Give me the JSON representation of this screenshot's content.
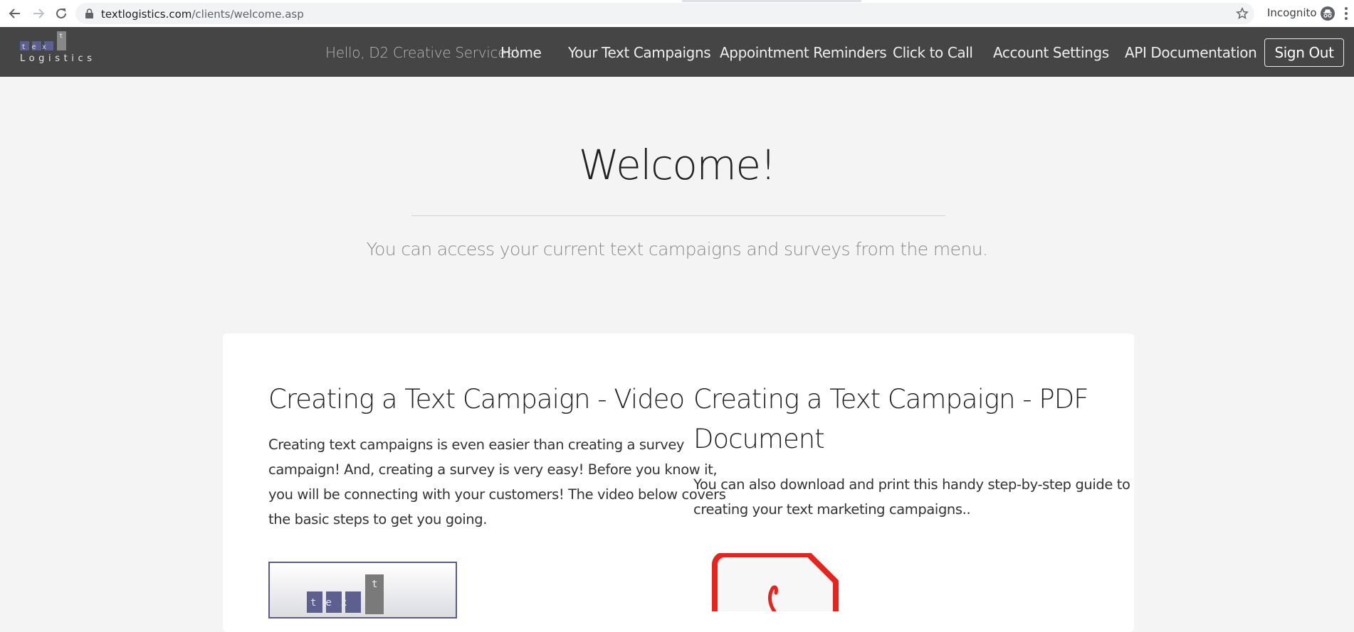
{
  "browser": {
    "url_domain": "textlogistics.com",
    "url_path": "/clients/welcome.asp",
    "incognito_label": "Incognito"
  },
  "nav": {
    "logo_text_top": "tex",
    "logo_text_t": "t",
    "logo_text_bottom": "Logistics",
    "greeting": "Hello, D2 Creative Services!",
    "links": [
      {
        "label": "Home"
      },
      {
        "label": "Your Text Campaigns"
      },
      {
        "label": "Appointment Reminders"
      },
      {
        "label": "Click to Call"
      },
      {
        "label": "Account Settings"
      },
      {
        "label": "API Documentation"
      }
    ],
    "signout_label": "Sign Out"
  },
  "hero": {
    "title": "Welcome!",
    "subtitle": "You can access your current text campaigns and surveys from the menu."
  },
  "sections": {
    "video": {
      "title": "Creating a Text Campaign - Video",
      "body_lines": [
        "Creating text campaigns is even easier than creating a survey",
        "campaign! And, creating a survey is very easy! Before you know it,",
        "you will be connecting with your customers! The video below covers",
        "the basic steps to get you going."
      ]
    },
    "pdf": {
      "title_lines": [
        "Creating a Text Campaign - PDF",
        "Document"
      ],
      "body_lines": [
        "You can also download and print this handy step-by-step guide to",
        "creating your text marketing campaigns.."
      ]
    }
  },
  "colors": {
    "nav_bg": "#454545",
    "page_bg": "#f4f4f4",
    "pdf_red": "#e8231c",
    "logo_tile": "#5d5f8f"
  },
  "icons": [
    "back-arrow-icon",
    "forward-arrow-icon",
    "reload-icon",
    "lock-icon",
    "star-icon",
    "incognito-icon",
    "kebab-menu-icon",
    "pdf-icon"
  ]
}
